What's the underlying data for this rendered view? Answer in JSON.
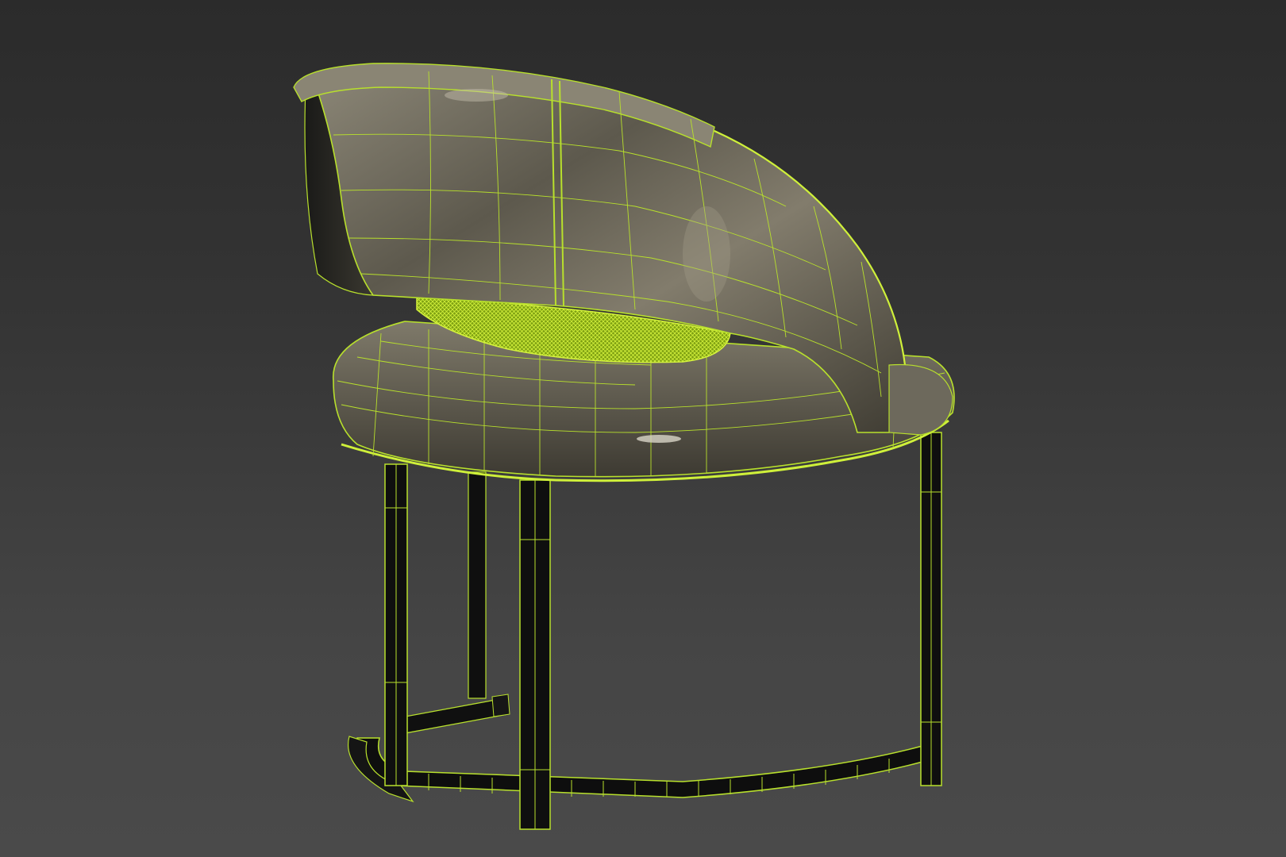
{
  "viewport": {
    "background_top": "#2b2b2b",
    "background_bottom": "#4a4a4a"
  },
  "model": {
    "wire_color": "#b8e02c",
    "wire_dense_color": "#cff03a",
    "shell_color": "#6e6a5c",
    "shell_highlight": "#9a9584",
    "shell_shadow": "#3c3a32",
    "frame_color": "#111111"
  }
}
